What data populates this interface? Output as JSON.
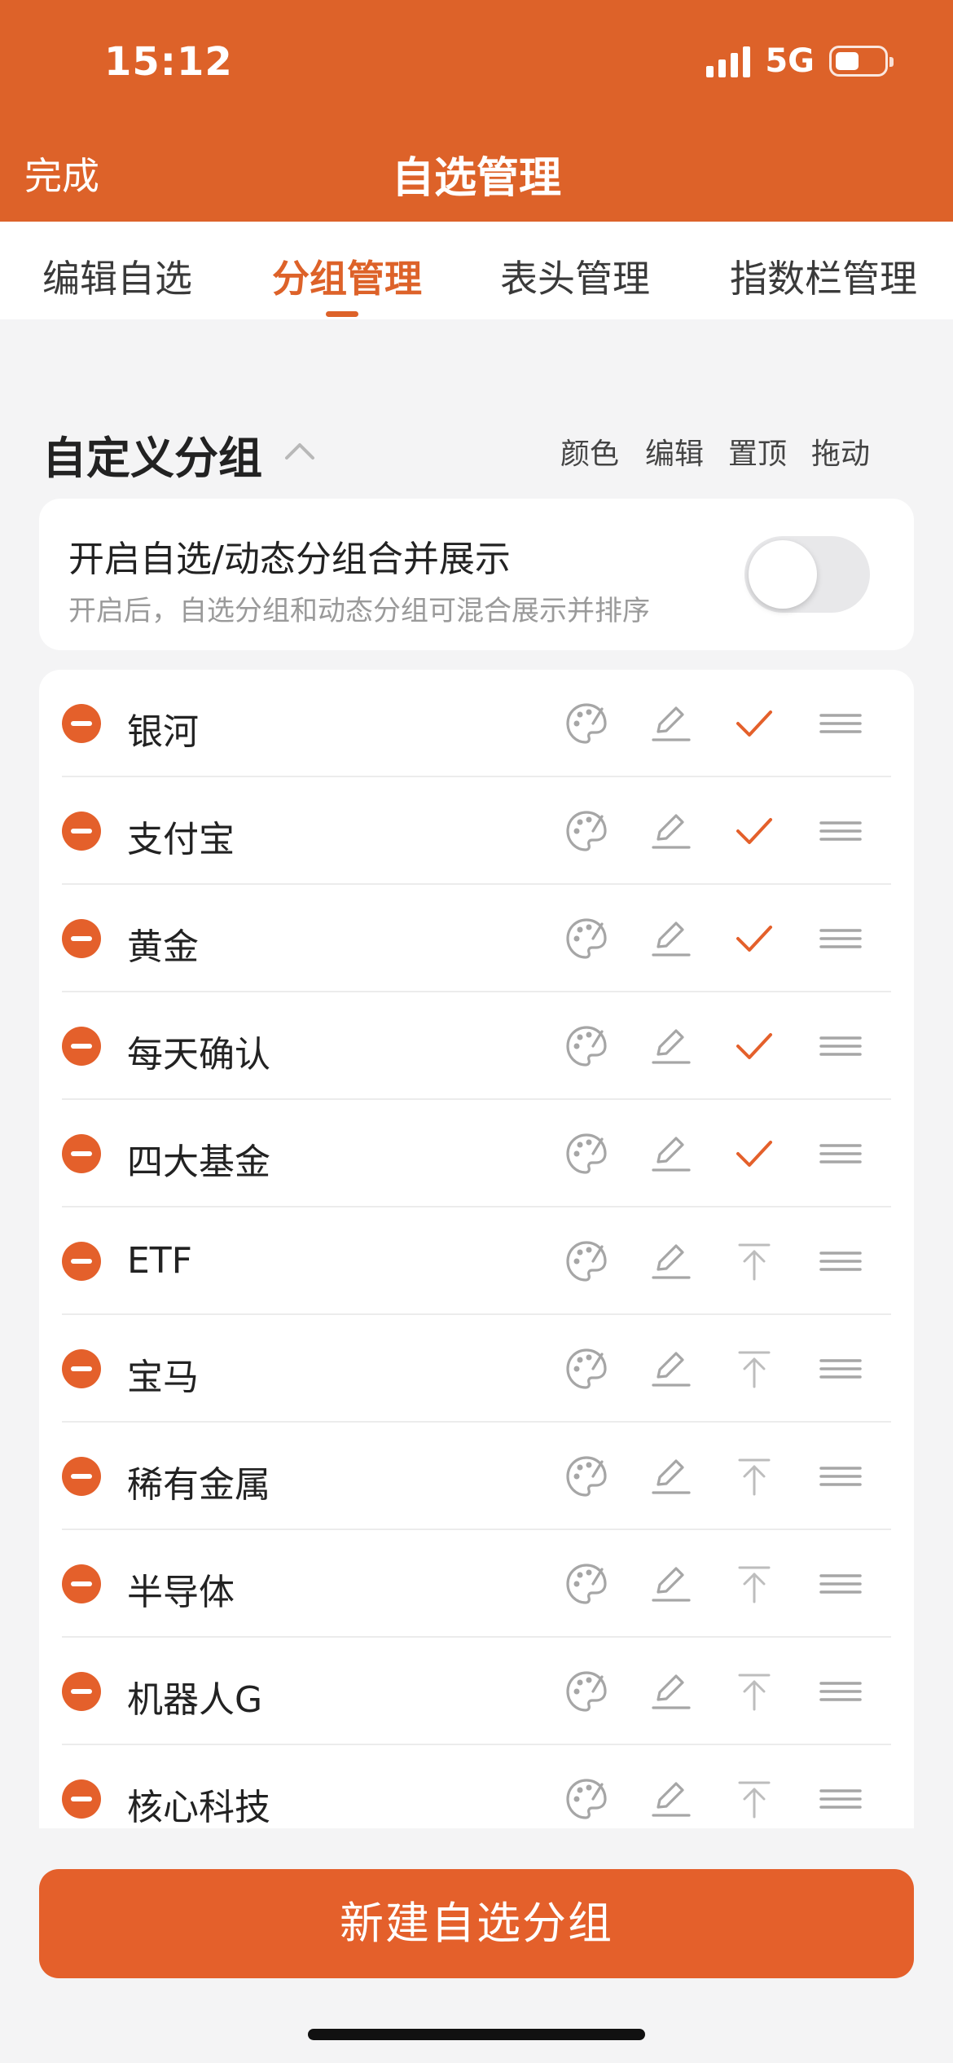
{
  "status_bar": {
    "time": "15:12",
    "network": "5G"
  },
  "nav": {
    "done_label": "完成",
    "title": "自选管理"
  },
  "tabs": [
    {
      "label": "编辑自选",
      "active": false
    },
    {
      "label": "分组管理",
      "active": true
    },
    {
      "label": "表头管理",
      "active": false
    },
    {
      "label": "指数栏管理",
      "active": false
    }
  ],
  "section": {
    "title": "自定义分组",
    "columns": {
      "color": "颜色",
      "edit": "编辑",
      "pin": "置顶",
      "drag": "拖动"
    }
  },
  "merge": {
    "title": "开启自选/动态分组合并展示",
    "description": "开启后，自选分组和动态分组可混合展示并排序",
    "enabled": false
  },
  "groups": [
    {
      "name": "银河",
      "pinned": true
    },
    {
      "name": "支付宝",
      "pinned": true
    },
    {
      "name": "黄金",
      "pinned": true
    },
    {
      "name": "每天确认",
      "pinned": true
    },
    {
      "name": "四大基金",
      "pinned": true
    },
    {
      "name": "ETF",
      "pinned": false
    },
    {
      "name": "宝马",
      "pinned": false
    },
    {
      "name": "稀有金属",
      "pinned": false
    },
    {
      "name": "半导体",
      "pinned": false
    },
    {
      "name": "机器人G",
      "pinned": false
    },
    {
      "name": "核心科技",
      "pinned": false
    }
  ],
  "footer": {
    "new_group_label": "新建自选分组"
  },
  "colors": {
    "accent": "#dd6229",
    "button": "#e4602b",
    "icon_gray": "#9a9a9a"
  }
}
